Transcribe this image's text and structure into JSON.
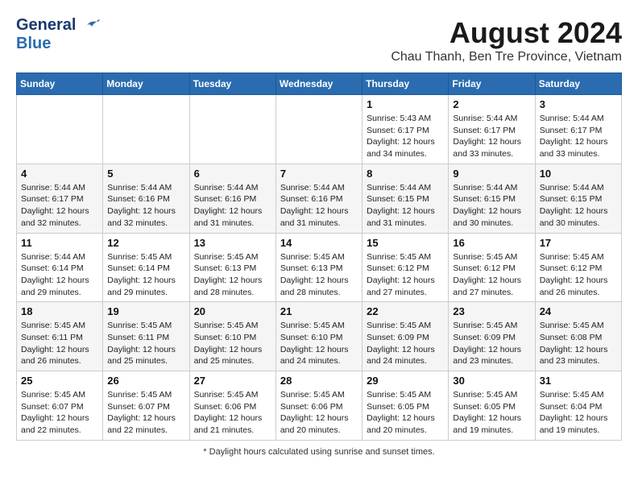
{
  "header": {
    "logo_line1": "General",
    "logo_line2": "Blue",
    "title": "August 2024",
    "subtitle": "Chau Thanh, Ben Tre Province, Vietnam"
  },
  "weekdays": [
    "Sunday",
    "Monday",
    "Tuesday",
    "Wednesday",
    "Thursday",
    "Friday",
    "Saturday"
  ],
  "weeks": [
    [
      {
        "day": "",
        "info": ""
      },
      {
        "day": "",
        "info": ""
      },
      {
        "day": "",
        "info": ""
      },
      {
        "day": "",
        "info": ""
      },
      {
        "day": "1",
        "info": "Sunrise: 5:43 AM\nSunset: 6:17 PM\nDaylight: 12 hours\nand 34 minutes."
      },
      {
        "day": "2",
        "info": "Sunrise: 5:44 AM\nSunset: 6:17 PM\nDaylight: 12 hours\nand 33 minutes."
      },
      {
        "day": "3",
        "info": "Sunrise: 5:44 AM\nSunset: 6:17 PM\nDaylight: 12 hours\nand 33 minutes."
      }
    ],
    [
      {
        "day": "4",
        "info": "Sunrise: 5:44 AM\nSunset: 6:17 PM\nDaylight: 12 hours\nand 32 minutes."
      },
      {
        "day": "5",
        "info": "Sunrise: 5:44 AM\nSunset: 6:16 PM\nDaylight: 12 hours\nand 32 minutes."
      },
      {
        "day": "6",
        "info": "Sunrise: 5:44 AM\nSunset: 6:16 PM\nDaylight: 12 hours\nand 31 minutes."
      },
      {
        "day": "7",
        "info": "Sunrise: 5:44 AM\nSunset: 6:16 PM\nDaylight: 12 hours\nand 31 minutes."
      },
      {
        "day": "8",
        "info": "Sunrise: 5:44 AM\nSunset: 6:15 PM\nDaylight: 12 hours\nand 31 minutes."
      },
      {
        "day": "9",
        "info": "Sunrise: 5:44 AM\nSunset: 6:15 PM\nDaylight: 12 hours\nand 30 minutes."
      },
      {
        "day": "10",
        "info": "Sunrise: 5:44 AM\nSunset: 6:15 PM\nDaylight: 12 hours\nand 30 minutes."
      }
    ],
    [
      {
        "day": "11",
        "info": "Sunrise: 5:44 AM\nSunset: 6:14 PM\nDaylight: 12 hours\nand 29 minutes."
      },
      {
        "day": "12",
        "info": "Sunrise: 5:45 AM\nSunset: 6:14 PM\nDaylight: 12 hours\nand 29 minutes."
      },
      {
        "day": "13",
        "info": "Sunrise: 5:45 AM\nSunset: 6:13 PM\nDaylight: 12 hours\nand 28 minutes."
      },
      {
        "day": "14",
        "info": "Sunrise: 5:45 AM\nSunset: 6:13 PM\nDaylight: 12 hours\nand 28 minutes."
      },
      {
        "day": "15",
        "info": "Sunrise: 5:45 AM\nSunset: 6:12 PM\nDaylight: 12 hours\nand 27 minutes."
      },
      {
        "day": "16",
        "info": "Sunrise: 5:45 AM\nSunset: 6:12 PM\nDaylight: 12 hours\nand 27 minutes."
      },
      {
        "day": "17",
        "info": "Sunrise: 5:45 AM\nSunset: 6:12 PM\nDaylight: 12 hours\nand 26 minutes."
      }
    ],
    [
      {
        "day": "18",
        "info": "Sunrise: 5:45 AM\nSunset: 6:11 PM\nDaylight: 12 hours\nand 26 minutes."
      },
      {
        "day": "19",
        "info": "Sunrise: 5:45 AM\nSunset: 6:11 PM\nDaylight: 12 hours\nand 25 minutes."
      },
      {
        "day": "20",
        "info": "Sunrise: 5:45 AM\nSunset: 6:10 PM\nDaylight: 12 hours\nand 25 minutes."
      },
      {
        "day": "21",
        "info": "Sunrise: 5:45 AM\nSunset: 6:10 PM\nDaylight: 12 hours\nand 24 minutes."
      },
      {
        "day": "22",
        "info": "Sunrise: 5:45 AM\nSunset: 6:09 PM\nDaylight: 12 hours\nand 24 minutes."
      },
      {
        "day": "23",
        "info": "Sunrise: 5:45 AM\nSunset: 6:09 PM\nDaylight: 12 hours\nand 23 minutes."
      },
      {
        "day": "24",
        "info": "Sunrise: 5:45 AM\nSunset: 6:08 PM\nDaylight: 12 hours\nand 23 minutes."
      }
    ],
    [
      {
        "day": "25",
        "info": "Sunrise: 5:45 AM\nSunset: 6:07 PM\nDaylight: 12 hours\nand 22 minutes."
      },
      {
        "day": "26",
        "info": "Sunrise: 5:45 AM\nSunset: 6:07 PM\nDaylight: 12 hours\nand 22 minutes."
      },
      {
        "day": "27",
        "info": "Sunrise: 5:45 AM\nSunset: 6:06 PM\nDaylight: 12 hours\nand 21 minutes."
      },
      {
        "day": "28",
        "info": "Sunrise: 5:45 AM\nSunset: 6:06 PM\nDaylight: 12 hours\nand 20 minutes."
      },
      {
        "day": "29",
        "info": "Sunrise: 5:45 AM\nSunset: 6:05 PM\nDaylight: 12 hours\nand 20 minutes."
      },
      {
        "day": "30",
        "info": "Sunrise: 5:45 AM\nSunset: 6:05 PM\nDaylight: 12 hours\nand 19 minutes."
      },
      {
        "day": "31",
        "info": "Sunrise: 5:45 AM\nSunset: 6:04 PM\nDaylight: 12 hours\nand 19 minutes."
      }
    ]
  ],
  "footer": "Daylight hours"
}
